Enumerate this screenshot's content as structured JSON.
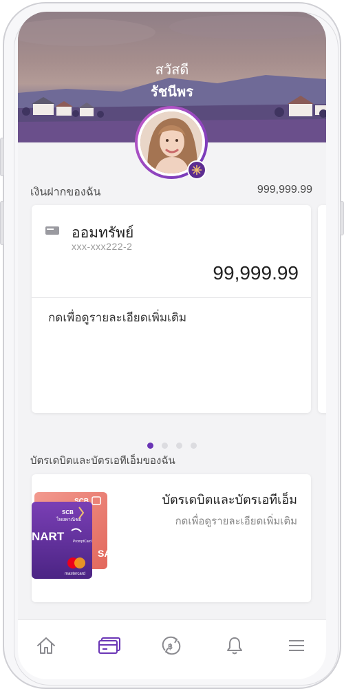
{
  "header": {
    "greeting": "สวัสดี",
    "name": "รัชนีพร"
  },
  "deposit": {
    "section_label": "เงินฝากของฉัน",
    "total": "999,999.99",
    "account": {
      "name": "ออมทรัพย์",
      "number": "xxx-xxx222-2",
      "balance": "99,999.99",
      "more_link": "กดเพื่อดูรายละเอียดเพิ่มเติม"
    },
    "pager": {
      "count": 4,
      "active": 0
    }
  },
  "cards": {
    "section_label": "บัตรเดบิตและบัตรเอทีเอ็มของฉัน",
    "title": "บัตรเดบิตและบัตรเอทีเอ็ม",
    "more_link": "กดเพื่อดูรายละเอียดเพิ่มเติม",
    "card_front": {
      "bank": "SCB",
      "bank_thai": "ไทยพาณิชย์",
      "brand": "NART",
      "network": "mastercard",
      "promptcard": "PromptCard"
    },
    "card_back": {
      "bank": "SCB",
      "network": "SA"
    }
  },
  "nav": {
    "items": [
      {
        "icon": "home-icon",
        "active": false
      },
      {
        "icon": "card-icon",
        "active": true
      },
      {
        "icon": "transfer-icon",
        "active": false
      },
      {
        "icon": "bell-icon",
        "active": false
      },
      {
        "icon": "menu-icon",
        "active": false
      }
    ]
  },
  "colors": {
    "accent": "#6a35b5",
    "inactive_icon": "#8a8a8f"
  }
}
